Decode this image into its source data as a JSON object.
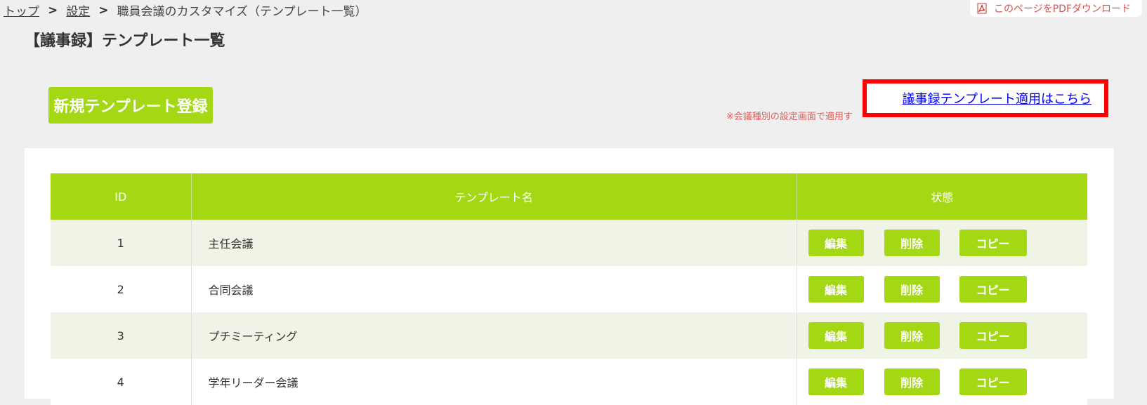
{
  "breadcrumb": {
    "top": "トップ",
    "settings": "設定",
    "current": "職員会議のカスタマイズ（テンプレート一覧）",
    "separator": ">"
  },
  "pdf_download": {
    "label": "このページをPDFダウンロード",
    "icon": "pdf-icon"
  },
  "page_title": "【議事録】テンプレート一覧",
  "new_template_button": "新規テンプレート登録",
  "apply_link": "議事録テンプレート適用はこちら",
  "note": "※会議種別の設定画面で適用す",
  "table": {
    "headers": [
      "ID",
      "テンプレート名",
      "状態"
    ],
    "rows": [
      {
        "id": "1",
        "name": "主任会議"
      },
      {
        "id": "2",
        "name": "合同会議"
      },
      {
        "id": "3",
        "name": "プチミーティング"
      },
      {
        "id": "4",
        "name": "学年リーダー会議"
      }
    ],
    "actions": {
      "edit": "編集",
      "delete": "削除",
      "copy": "コピー"
    }
  },
  "colors": {
    "accent_green": "#a5d814",
    "highlight_red": "#ff0000",
    "link_blue": "#0000ee",
    "note_red": "#e05a5a"
  }
}
